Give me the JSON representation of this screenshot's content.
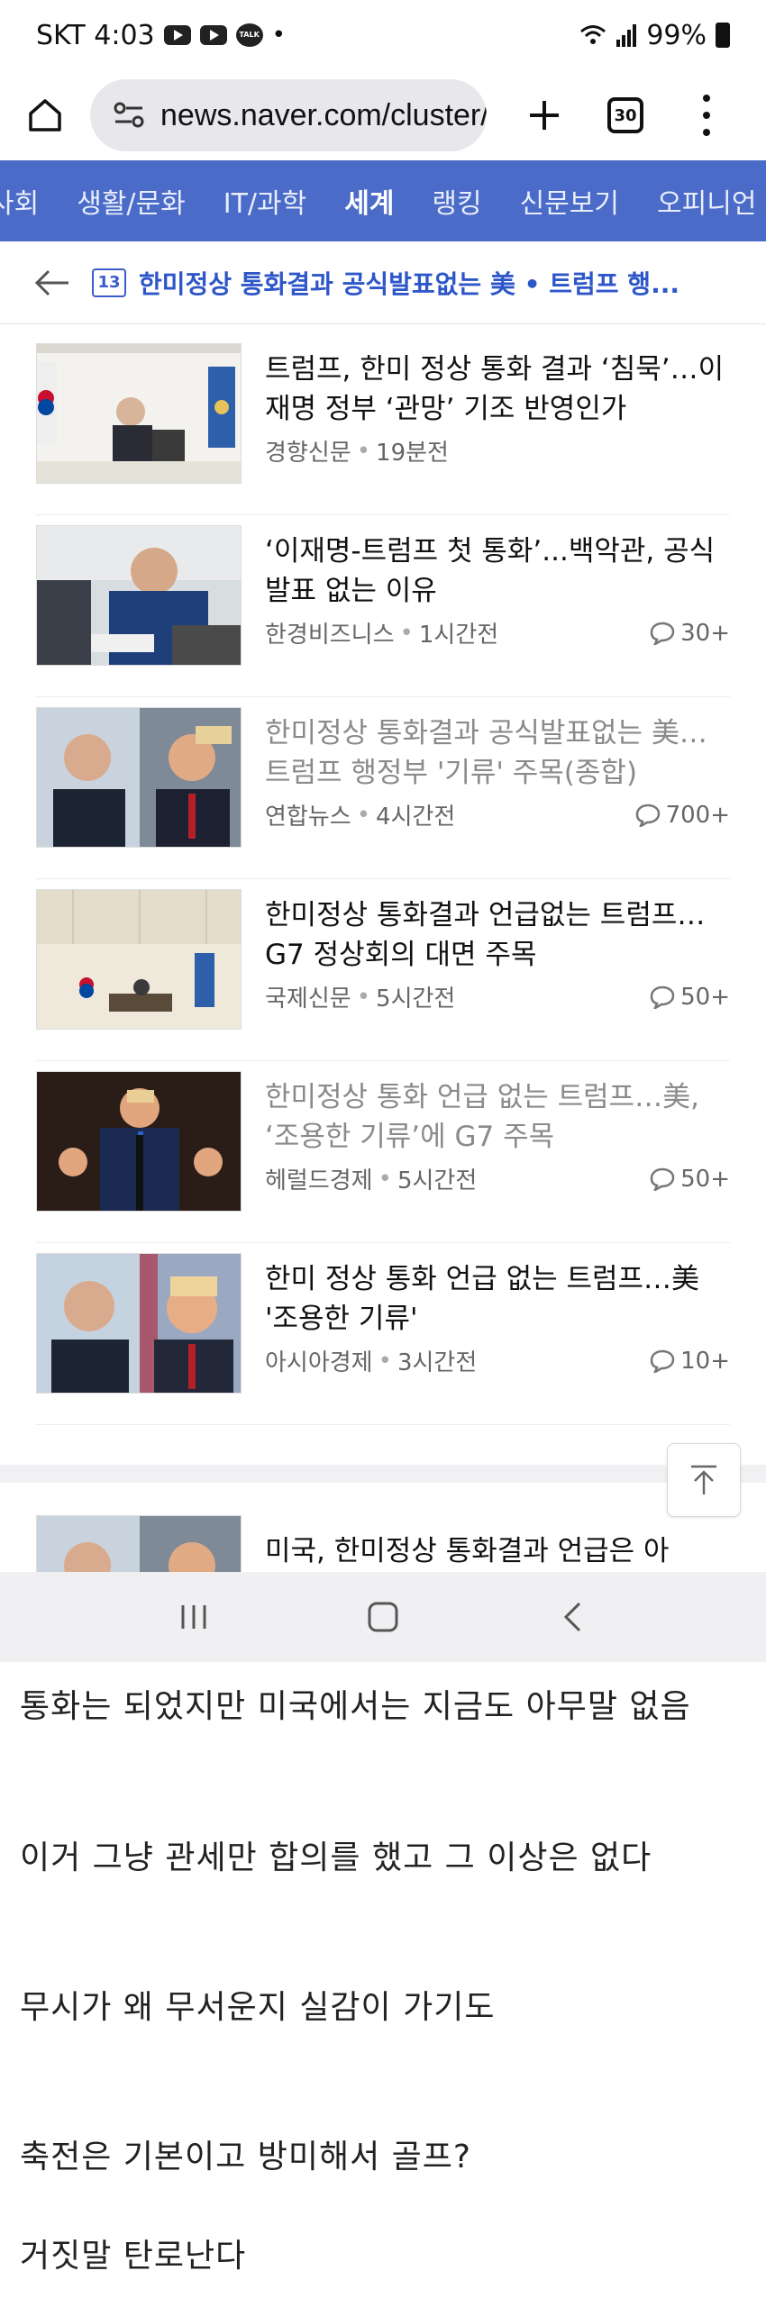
{
  "status_bar": {
    "carrier_time": "SKT 4:03",
    "battery": "99%"
  },
  "browser": {
    "url": "news.naver.com/cluster/",
    "tab_count": "30"
  },
  "nav": {
    "tabs": [
      {
        "label": "사회"
      },
      {
        "label": "생활/문화"
      },
      {
        "label": "IT/과학"
      },
      {
        "label": "세계",
        "active": true
      },
      {
        "label": "랭킹"
      },
      {
        "label": "신문보기"
      },
      {
        "label": "오피니언"
      }
    ]
  },
  "cluster": {
    "count": "13",
    "title": "한미정상 통화결과 공식발표없는 美 • 트럼프 행..."
  },
  "articles": [
    {
      "title": "트럼프, 한미 정상 통화 결과 ‘침묵’…이재명 정부 ‘관망’ 기조 반영인가",
      "source": "경향신문",
      "time": "19분전",
      "comments": ""
    },
    {
      "title": "‘이재명-트럼프 첫 통화’...백악관, 공식발표 없는 이유",
      "source": "한경비즈니스",
      "time": "1시간전",
      "comments": "30+"
    },
    {
      "title": "한미정상 통화결과 공식발표없는 美…트럼프 행정부 '기류' 주목(종합)",
      "source": "연합뉴스",
      "time": "4시간전",
      "comments": "700+"
    },
    {
      "title": "한미정상 통화결과 언급없는 트럼프…G7 정상회의 대면 주목",
      "source": "국제신문",
      "time": "5시간전",
      "comments": "50+"
    },
    {
      "title": "한미정상 통화 언급 없는 트럼프…美, ‘조용한 기류’에 G7 주목",
      "source": "헤럴드경제",
      "time": "5시간전",
      "comments": "50+"
    },
    {
      "title": "한미 정상 통화 언급 없는 트럼프…美 '조용한 기류'",
      "source": "아시아경제",
      "time": "3시간전",
      "comments": "10+"
    }
  ],
  "partial_article": {
    "title": "미국, 한미정상 통화결과 언급은 아직…'조용한 기류' 주목"
  },
  "comment_lines": [
    "통화는 되었지만 미국에서는 지금도 아무말 없음",
    "이거 그냥 관세만 합의를 했고 그 이상은 없다",
    "무시가 왜 무서운지 실감이 가기도",
    "축전은 기본이고 방미해서 골프?",
    "거짓말 탄로난다"
  ],
  "colors": {
    "nav_bg": "#4a6bc7",
    "cluster_title": "#2d56c9"
  }
}
